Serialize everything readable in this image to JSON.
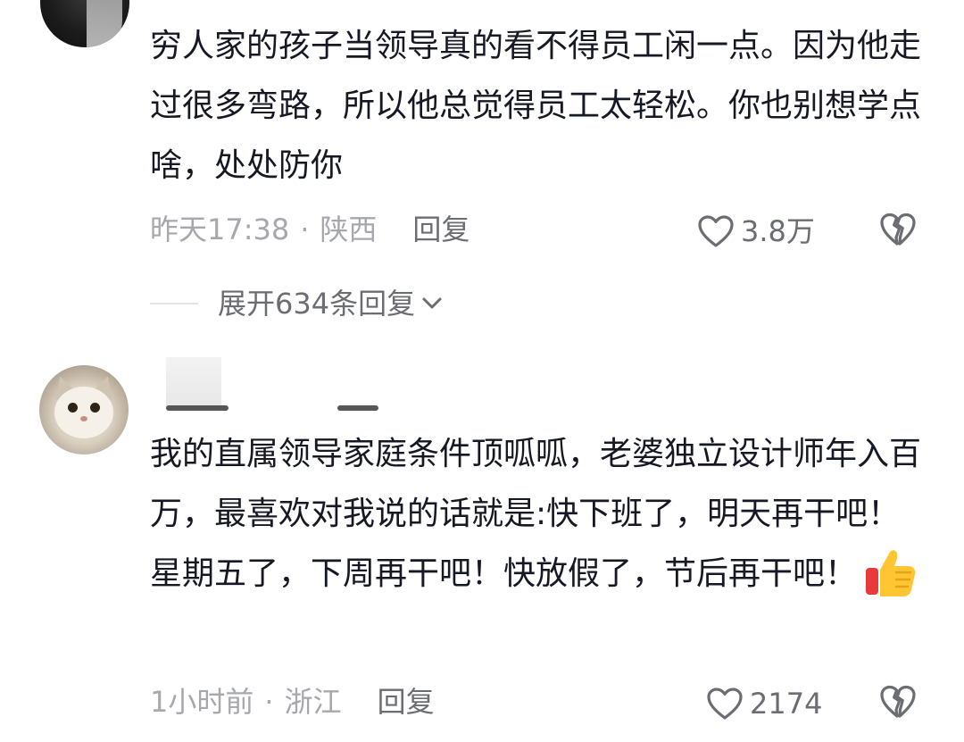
{
  "comments": [
    {
      "text": "穷人家的孩子当领导真的看不得员工闲一点。因为他走过很多弯路，所以他总觉得员工太轻松。你也别想学点啥，处处防你",
      "time": "昨天17:38",
      "separator": "·",
      "location": "陕西",
      "reply_label": "回复",
      "like_count": "3.8万",
      "expand_replies_label": "展开634条回复"
    },
    {
      "text": "我的直属领导家庭条件顶呱呱，老婆独立设计师年入百万，最喜欢对我说的话就是:快下班了，明天再干吧！星期五了，下周再干吧！快放假了，节后再干吧！",
      "emoji": "thumbs-up-emoji",
      "time": "1小时前",
      "separator": "·",
      "location": "浙江",
      "reply_label": "回复",
      "like_count": "2174"
    }
  ],
  "icons": {
    "like": "heart-outline-icon",
    "dislike": "broken-heart-icon",
    "expand": "chevron-down-icon"
  },
  "colors": {
    "text_primary": "#161823",
    "text_meta": "#a7a8ad",
    "text_action": "#6b6d73"
  }
}
